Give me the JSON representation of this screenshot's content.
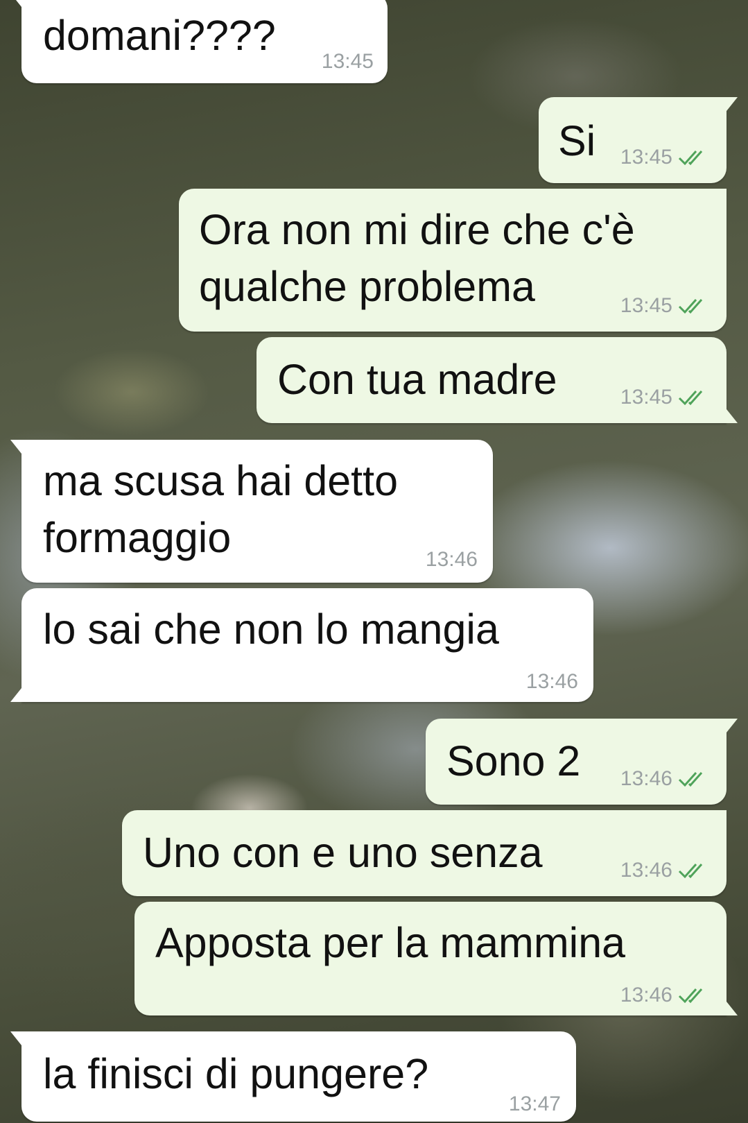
{
  "colors": {
    "incoming_bubble": "#ffffff",
    "outgoing_bubble": "#eef8e4",
    "timestamp": "#9aa0a2",
    "read_ticks": "#4fa35a"
  },
  "messages": [
    {
      "direction": "incoming",
      "text": "domani????",
      "time": "13:45"
    },
    {
      "direction": "outgoing",
      "text": "Si",
      "time": "13:45",
      "status_icon": "double-check-icon"
    },
    {
      "direction": "outgoing",
      "text": "Ora non mi dire che c'è\nqualche problema",
      "time": "13:45",
      "status_icon": "double-check-icon"
    },
    {
      "direction": "outgoing",
      "text": "Con tua madre",
      "time": "13:45",
      "status_icon": "double-check-icon"
    },
    {
      "direction": "incoming",
      "text": "ma scusa hai detto\nformaggio",
      "time": "13:46"
    },
    {
      "direction": "incoming",
      "text": "lo sai che non lo mangia",
      "time": "13:46"
    },
    {
      "direction": "outgoing",
      "text": "Sono 2",
      "time": "13:46",
      "status_icon": "double-check-icon"
    },
    {
      "direction": "outgoing",
      "text": "Uno con e uno senza",
      "time": "13:46",
      "status_icon": "double-check-icon"
    },
    {
      "direction": "outgoing",
      "text": "Apposta per la mammina",
      "time": "13:46",
      "status_icon": "double-check-icon"
    },
    {
      "direction": "incoming",
      "text": "la finisci di pungere?",
      "time": "13:47"
    }
  ]
}
